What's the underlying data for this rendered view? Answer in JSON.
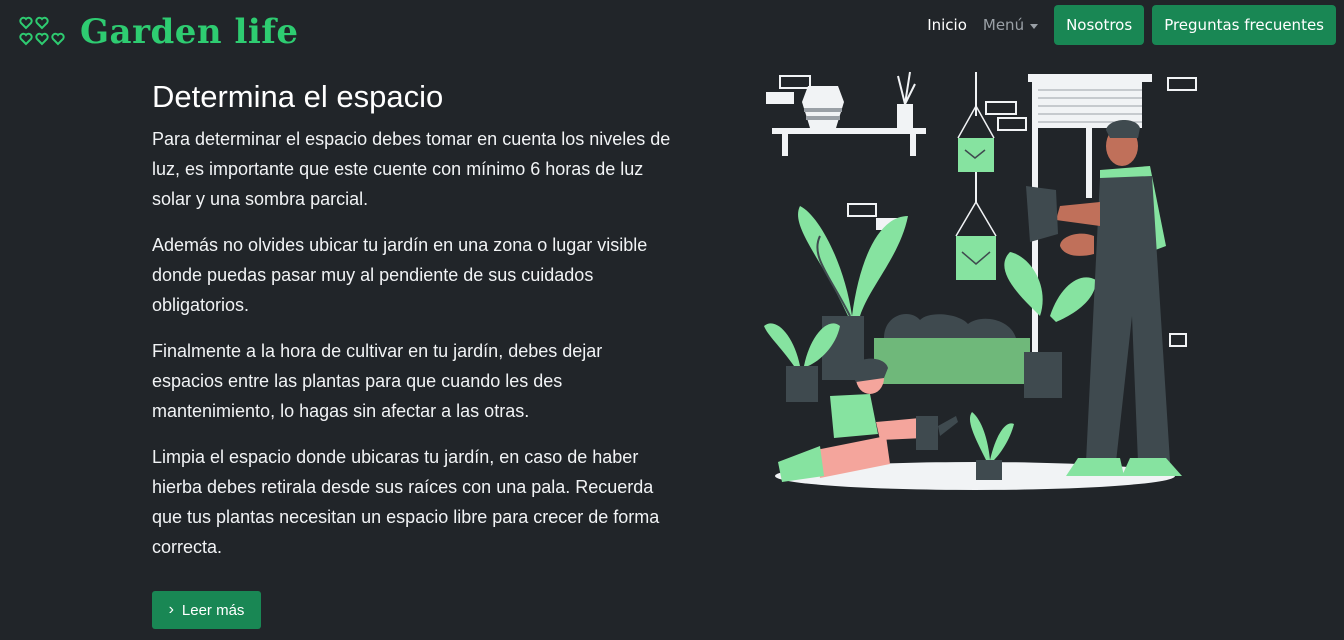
{
  "brand": {
    "name": "Garden life",
    "logo_icon": "hearts-logo-icon"
  },
  "nav": {
    "home": "Inicio",
    "menu": "Menú",
    "about": "Nosotros",
    "faq": "Preguntas frecuentes"
  },
  "article": {
    "title": "Determina el espacio",
    "paragraphs": [
      "Para determinar el espacio debes tomar en cuenta los niveles de luz, es importante que este cuente con mínimo 6 horas de luz solar y una sombra parcial.",
      "Además no olvides ubicar tu jardín en una zona o lugar visible donde puedas pasar muy al pendiente de sus cuidados obligatorios.",
      "Finalmente a la hora de cultivar en tu jardín, debes dejar espacios entre las plantas para que cuando les des mantenimiento, lo hagas sin afectar a las otras.",
      "Limpia el espacio donde ubicaras tu jardín, en caso de haber hierba debes retirala desde sus raíces con una pala. Recuerda que tus plantas necesitan un espacio libre para crecer de forma correcta."
    ],
    "read_more": "Leer más",
    "read_more_icon": "chevron-right-icon"
  },
  "colors": {
    "background": "#212529",
    "brand_green": "#2ecc71",
    "button_green": "#198754",
    "plant_green": "#86e3a0",
    "dark_slate": "#3f4a4f"
  }
}
